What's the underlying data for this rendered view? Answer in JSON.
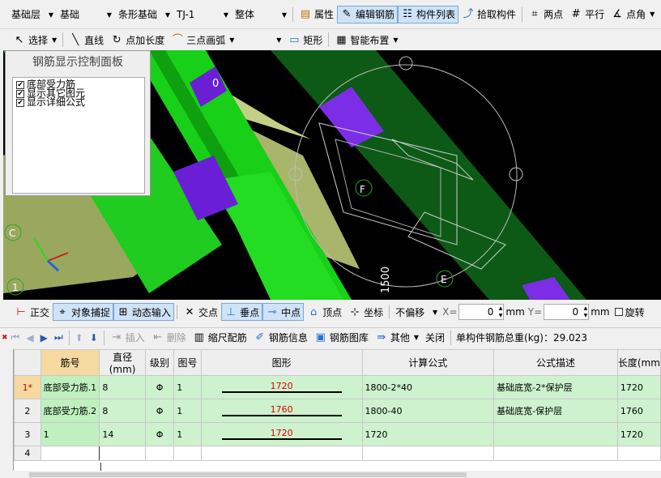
{
  "toolbar1": {
    "floor": "基础层",
    "category": "基础",
    "type": "条形基础",
    "member": "TJ-1",
    "scope": "整体",
    "buttons": [
      "属性",
      "编辑钢筋",
      "构件列表",
      "拾取构件",
      "两点",
      "平行",
      "点角"
    ]
  },
  "toolbar2": {
    "select": "选择",
    "line": "直线",
    "point_length": "点加长度",
    "arc": "三点画弧",
    "rect": "矩形",
    "smart": "智能布置"
  },
  "panel": {
    "title": "钢筋显示控制面板",
    "options": [
      "底部受力筋",
      "显示其它图元",
      "显示详细公式"
    ]
  },
  "viewport": {
    "labels": {
      "top_num": "0",
      "F": "F",
      "C": "C",
      "one": "1",
      "E": "E",
      "dim": "1500"
    },
    "colors": {
      "green": "#22cc22",
      "purple": "#6a1fd6",
      "olive": "#a8b56a",
      "background": "#000000"
    }
  },
  "snapbar": {
    "ortho": "正交",
    "snap": "对象捕捉",
    "dyn": "动态输入",
    "intersect": "交点",
    "perp": "垂点",
    "mid": "中点",
    "vertex": "顶点",
    "coord": "坐标",
    "offset": "不偏移",
    "x_label": "X=",
    "x_val": "0",
    "y_label": "Y=",
    "y_val": "0",
    "unit": "mm",
    "rotate": "旋转"
  },
  "gridbar": {
    "insert": "插入",
    "delete": "删除",
    "scale": "缩尺配筋",
    "info": "钢筋信息",
    "lib": "钢筋图库",
    "other": "其他",
    "close": "关闭",
    "total": "单构件钢筋总重(kg)：29.023"
  },
  "table": {
    "headers": [
      "筋号",
      "直径(mm)",
      "级别",
      "图号",
      "图形",
      "计算公式",
      "公式描述",
      "长度(mm"
    ],
    "rows": [
      {
        "rn": "1*",
        "name": "底部受力筋.1",
        "dia": "8",
        "grade": "Φ",
        "fig": "1",
        "shape": "1720",
        "formula": "1800-2*40",
        "desc": "基础底宽-2*保护层",
        "len": "1720"
      },
      {
        "rn": "2",
        "name": "底部受力筋.2",
        "dia": "8",
        "grade": "Φ",
        "fig": "1",
        "shape": "1760",
        "formula": "1800-40",
        "desc": "基础底宽-保护层",
        "len": "1760"
      },
      {
        "rn": "3",
        "name": "1",
        "dia": "14",
        "grade": "Φ",
        "fig": "1",
        "shape": "1720",
        "formula": "1720",
        "desc": "",
        "len": "1720"
      },
      {
        "rn": "4",
        "name": "",
        "dia": "",
        "grade": "",
        "fig": "",
        "shape": "",
        "formula": "",
        "desc": "",
        "len": ""
      }
    ]
  }
}
